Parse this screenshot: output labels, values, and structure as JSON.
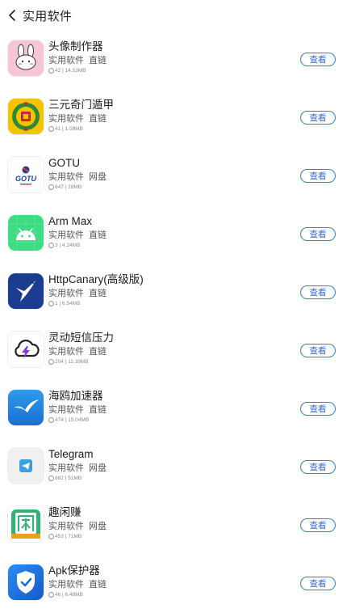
{
  "header": {
    "back_icon": "chevron-left-icon",
    "title": "实用软件"
  },
  "apps": [
    {
      "name": "头像制作器",
      "category": "实用软件",
      "link_type": "直链",
      "stats": "42 | 14.53MB",
      "icon": "bunny-avatar-icon",
      "action": "查看"
    },
    {
      "name": "三元奇门遁甲",
      "category": "实用软件",
      "link_type": "直链",
      "stats": "41 | 1.58MB",
      "icon": "qimen-emblem-icon",
      "action": "查看"
    },
    {
      "name": "GOTU",
      "category": "实用软件",
      "link_type": "网盘",
      "stats": "647 | 28MB",
      "icon": "gotu-logo-icon",
      "action": "查看"
    },
    {
      "name": "Arm Max",
      "category": "实用软件",
      "link_type": "直链",
      "stats": "3 | 4.24MB",
      "icon": "android-robot-icon",
      "action": "查看"
    },
    {
      "name": "HttpCanary(高级版)",
      "category": "实用软件",
      "link_type": "直链",
      "stats": "1 | 6.54MB",
      "icon": "canary-bird-icon",
      "action": "查看"
    },
    {
      "name": "灵动短信压力",
      "category": "实用软件",
      "link_type": "直链",
      "stats": "204 | 11.39MB",
      "icon": "lightning-cloud-icon",
      "action": "查看"
    },
    {
      "name": "海鸥加速器",
      "category": "实用软件",
      "link_type": "直链",
      "stats": "474 | 15.04MB",
      "icon": "seagull-icon",
      "action": "查看"
    },
    {
      "name": "Telegram",
      "category": "实用软件",
      "link_type": "网盘",
      "stats": "882 | 51MB",
      "icon": "telegram-plane-icon",
      "action": "查看"
    },
    {
      "name": "趣闲赚",
      "category": "实用软件",
      "link_type": "网盘",
      "stats": "453 | 71MB",
      "icon": "xian-character-icon",
      "action": "查看"
    },
    {
      "name": "Apk保护器",
      "category": "实用软件",
      "link_type": "直链",
      "stats": "46 | 6.48MB",
      "icon": "shield-check-icon",
      "action": "查看"
    }
  ]
}
